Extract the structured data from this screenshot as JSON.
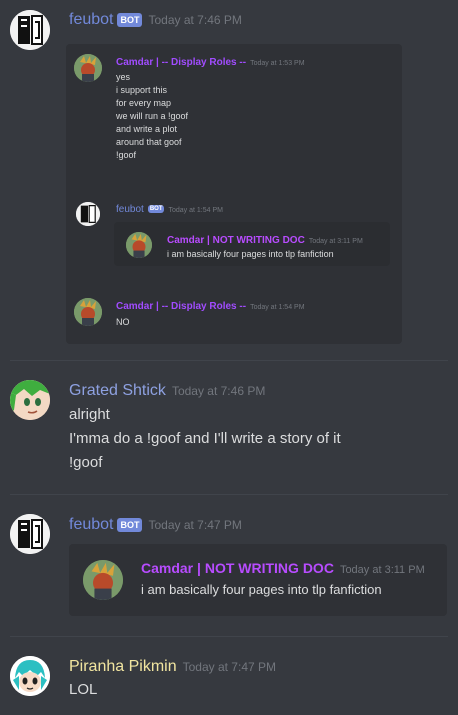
{
  "messages": [
    {
      "author": "feubot",
      "bot_badge": "BOT",
      "timestamp": "Today at 7:46 PM",
      "embed": {
        "quotes": [
          {
            "author": "Camdar | -- Display Roles --",
            "timestamp": "Today at 1:53 PM",
            "lines": [
              "yes",
              "i support this",
              "for every map",
              "we will run a !goof",
              "and write a plot",
              "around that goof",
              "!goof"
            ]
          },
          {
            "author": "feubot",
            "bot_badge": "BOT",
            "timestamp": "Today at 1:54 PM",
            "inner": {
              "author": "Camdar | NOT WRITING DOC",
              "timestamp": "Today at 3:11 PM",
              "text": "i am basically four pages into tlp fanfiction"
            }
          },
          {
            "author": "Camdar | -- Display Roles --",
            "timestamp": "Today at 1:54 PM",
            "lines": [
              "NO"
            ]
          }
        ]
      }
    },
    {
      "author": "Grated Shtick",
      "timestamp": "Today at 7:46 PM",
      "lines": [
        "alright",
        "I'mma do a !goof and I'll write a story of it",
        "!goof"
      ]
    },
    {
      "author": "feubot",
      "bot_badge": "BOT",
      "timestamp": "Today at 7:47 PM",
      "embed": {
        "author": "Camdar | NOT WRITING DOC",
        "timestamp": "Today at 3:11 PM",
        "text": "i am basically four pages into tlp fanfiction"
      }
    },
    {
      "author": "Piranha Pikmin",
      "timestamp": "Today at 7:47 PM",
      "lines": [
        "LOL"
      ]
    }
  ],
  "colors": {
    "background": "#36393f",
    "embed_bg": "#2f3136",
    "feubot_name": "#7289da",
    "grated_name": "#8ea1e1",
    "piranha_name": "#f1e5a0",
    "camdar_name": "#a14cff",
    "bot_badge": "#7289da"
  }
}
